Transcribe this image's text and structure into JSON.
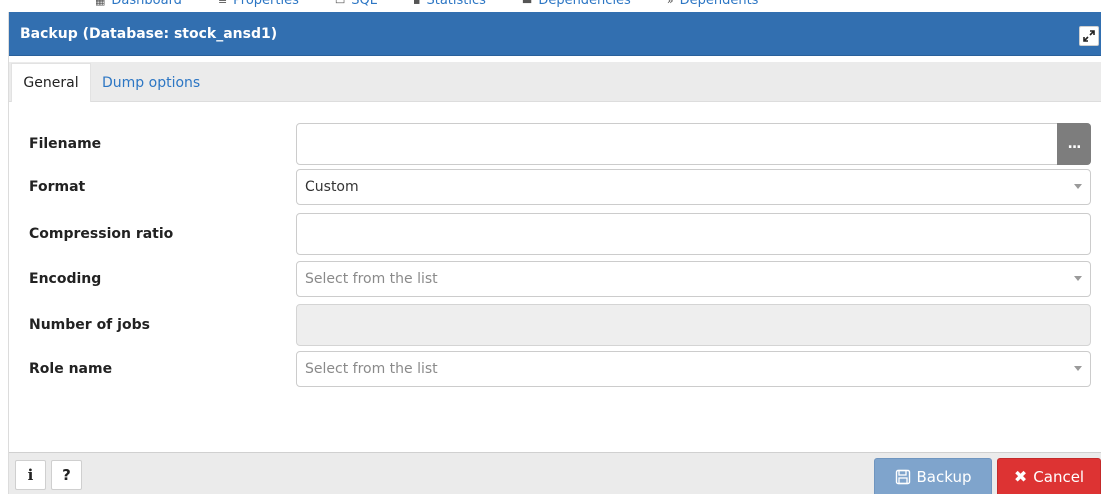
{
  "background_tabs": [
    {
      "label": "Dashboard",
      "icon": "dashboard-icon"
    },
    {
      "label": "Properties",
      "icon": "properties-icon"
    },
    {
      "label": "SQL",
      "icon": "sql-icon"
    },
    {
      "label": "Statistics",
      "icon": "statistics-icon"
    },
    {
      "label": "Dependencies",
      "icon": "dependencies-icon"
    },
    {
      "label": "Dependents",
      "icon": "dependents-icon"
    }
  ],
  "dialog": {
    "title": "Backup (Database: stock_ansd1)",
    "maximize_icon": "expand-icon",
    "title_bar_color": "#326fb0"
  },
  "tabs": [
    {
      "label": "General",
      "active": true
    },
    {
      "label": "Dump options",
      "active": false
    }
  ],
  "form": {
    "filename": {
      "label": "Filename",
      "value": "",
      "browse_label": "..."
    },
    "format": {
      "label": "Format",
      "value": "Custom"
    },
    "compression": {
      "label": "Compression ratio",
      "value": ""
    },
    "encoding": {
      "label": "Encoding",
      "placeholder": "Select from the list"
    },
    "jobs": {
      "label": "Number of jobs",
      "value": ""
    },
    "role": {
      "label": "Role name",
      "placeholder": "Select from the list"
    }
  },
  "footer": {
    "info_label": "i",
    "help_label": "?",
    "backup_label": "Backup",
    "backup_icon": "save-icon",
    "cancel_label": "Cancel",
    "cancel_icon": "close-icon",
    "backup_color": "#7fa4cc",
    "cancel_color": "#dd3333"
  }
}
